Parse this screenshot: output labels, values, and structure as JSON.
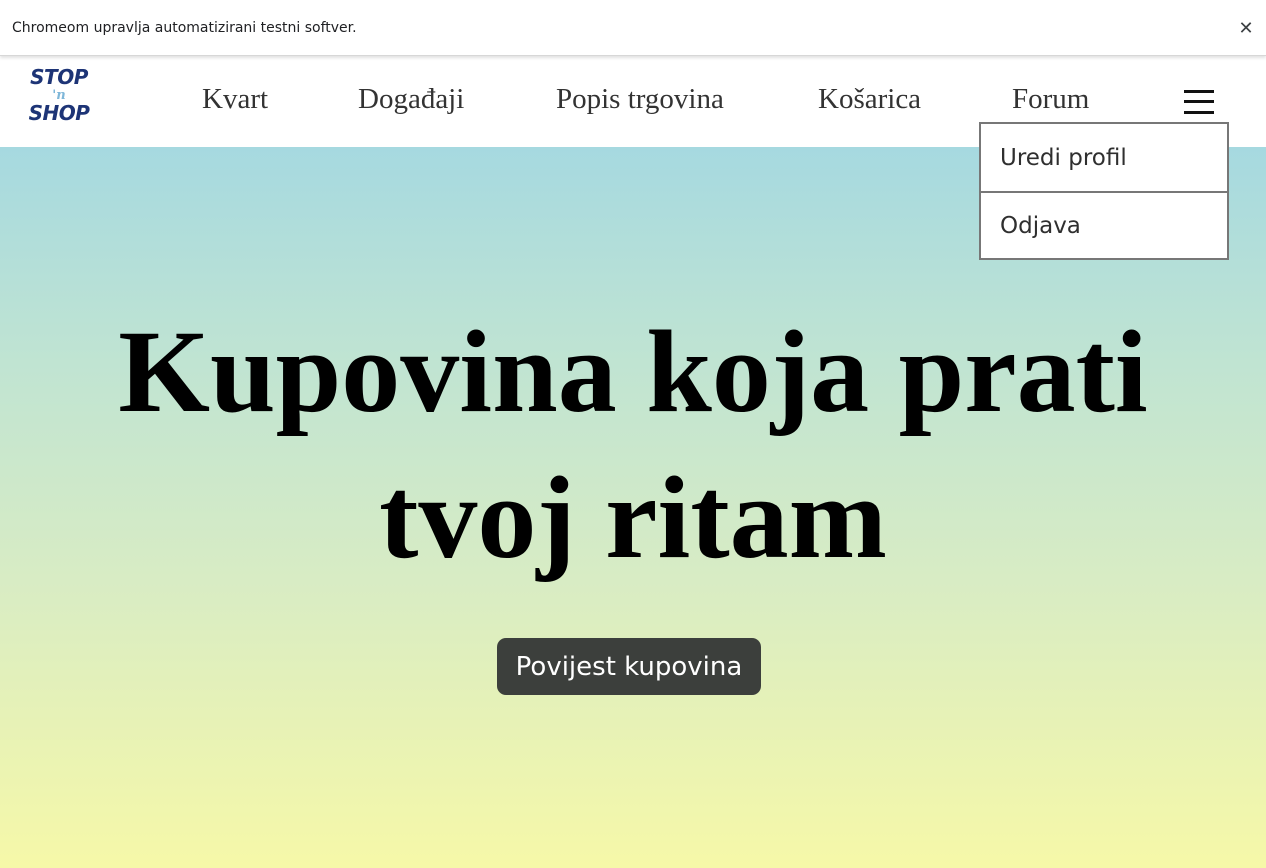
{
  "infobar": {
    "message": "Chromeom upravlja automatizirani testni softver.",
    "close_glyph": "✕"
  },
  "logo": {
    "line1": "STOP",
    "line2": "'n",
    "line3": "SHOP"
  },
  "nav": {
    "links": [
      {
        "label": "Kvart"
      },
      {
        "label": "Događaji"
      },
      {
        "label": "Popis trgovina"
      },
      {
        "label": "Košarica"
      },
      {
        "label": "Forum"
      }
    ],
    "menu_icon": "hamburger-icon"
  },
  "dropdown": {
    "items": [
      {
        "label": "Uredi profil"
      },
      {
        "label": "Odjava"
      }
    ]
  },
  "hero": {
    "title_line1": "Kupovina koja prati",
    "title_line2": "tvoj ritam",
    "button_label": "Povijest kupovina"
  },
  "colors": {
    "logo_primary": "#1d3476",
    "logo_accent": "#7fb7d9",
    "button_bg": "#3c3f3c",
    "gradient_top": "#a6d9e0",
    "gradient_bottom": "#f6f8a8"
  }
}
